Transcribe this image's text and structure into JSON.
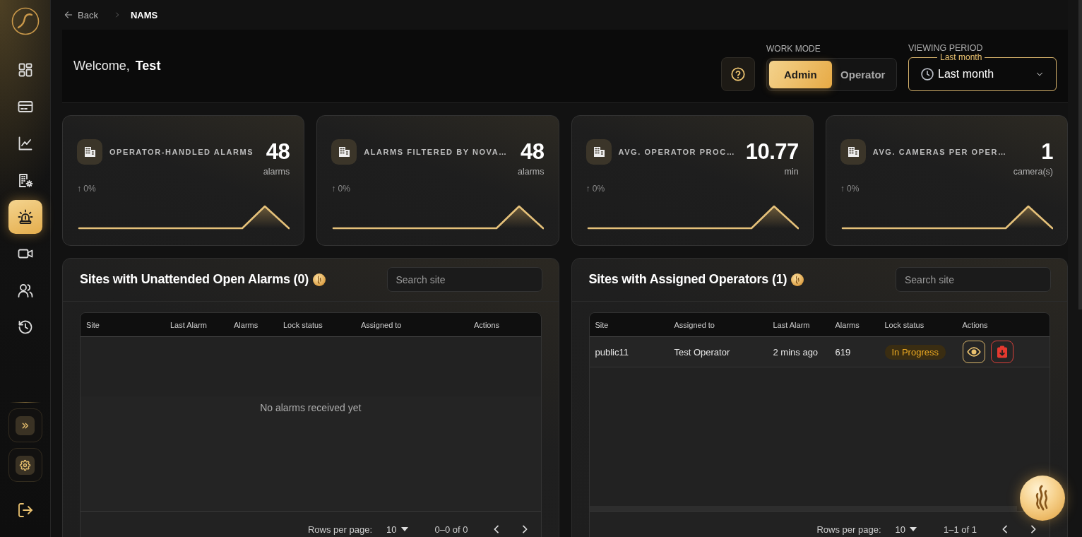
{
  "sidebar": {
    "nav_items": [
      {
        "selected": false
      },
      {
        "selected": false
      },
      {
        "selected": false
      },
      {
        "selected": false
      },
      {
        "selected": true
      },
      {
        "selected": false
      },
      {
        "selected": false
      },
      {
        "selected": false
      }
    ]
  },
  "breadcrumb": {
    "back": "Back",
    "current": "NAMS"
  },
  "header": {
    "welcome": "Welcome, **Test**",
    "work_mode": {
      "label": "WORK MODE",
      "options": [
        {
          "label": "Admin",
          "selected": true
        },
        {
          "label": "Operator",
          "selected": false
        }
      ]
    },
    "viewing_period": {
      "label": "VIEWING PERIOD",
      "floating_label": "Last month",
      "value": "Last month"
    }
  },
  "stats": [
    {
      "title": "OPERATOR-HANDLED ALARMS",
      "value": "48",
      "unit": "alarms",
      "change": "↑ 0%"
    },
    {
      "title": "ALARMS FILTERED BY NOVA…",
      "value": "48",
      "unit": "alarms",
      "change": "↑ 0%"
    },
    {
      "title": "AVG. OPERATOR PROC…",
      "value": "10.77",
      "unit": "min",
      "change": "↑ 0%"
    },
    {
      "title": "AVG. CAMERAS PER OPER…",
      "value": "1",
      "unit": "camera(s)",
      "change": "↑ 0%"
    }
  ],
  "panels": [
    {
      "title": "Sites with Unattended Open Alarms (0)",
      "search": {
        "placeholder": "Search site"
      },
      "table": {
        "columns": [
          "Site",
          "Last Alarm",
          "Alarms",
          "Lock status",
          "Assigned to",
          "Actions"
        ],
        "empty_message": "No alarms received yet"
      },
      "pagination": {
        "rows_per_page_label": "Rows per page:",
        "rows_per_page": "10",
        "range": "0–0 of 0"
      }
    },
    {
      "title": "Sites with Assigned Operators (1)",
      "search": {
        "placeholder": "Search site"
      },
      "table": {
        "columns": [
          "Site",
          "Assigned to",
          "Last Alarm",
          "Alarms",
          "Lock status",
          "Actions"
        ],
        "rows": [
          {
            "cells": [
              {
                "kind": "text",
                "text": "public11"
              },
              {
                "kind": "text",
                "text": "Test Operator"
              },
              {
                "kind": "text",
                "text": "2 mins ago"
              },
              {
                "kind": "text",
                "text": "619"
              },
              {
                "kind": "status",
                "text": "In Progress"
              },
              {
                "kind": "actions"
              }
            ]
          }
        ]
      },
      "pagination": {
        "rows_per_page_label": "Rows per page:",
        "rows_per_page": "10",
        "range": "1–1 of 1"
      }
    }
  ]
}
